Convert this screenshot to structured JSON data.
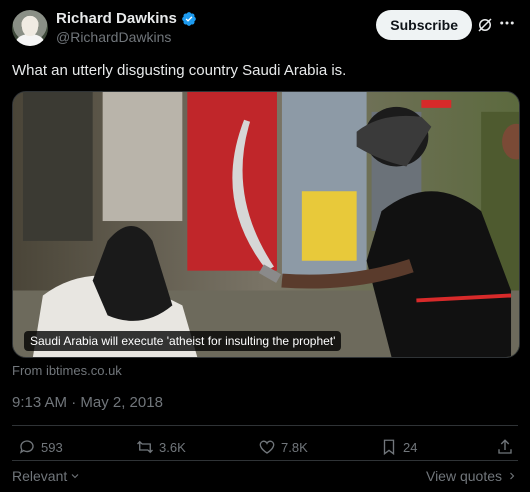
{
  "author": {
    "name": "Richard Dawkins",
    "handle": "@RichardDawkins",
    "verified": true
  },
  "header": {
    "subscribe_label": "Subscribe"
  },
  "tweet": {
    "text": "What an utterly disgusting country Saudi Arabia is.",
    "media_caption": "Saudi Arabia will execute 'atheist for insulting the prophet'",
    "source": "From ibtimes.co.uk",
    "timestamp": "9:13 AM · May 2, 2018"
  },
  "actions": {
    "replies": "593",
    "retweets": "3.6K",
    "likes": "7.8K",
    "bookmarks": "24"
  },
  "footer": {
    "sort_label": "Relevant",
    "view_quotes_label": "View quotes"
  },
  "icons": {
    "verified": "verified-badge-icon",
    "grok": "grok-icon",
    "more": "more-icon",
    "reply": "reply-icon",
    "retweet": "retweet-icon",
    "like": "heart-icon",
    "bookmark": "bookmark-icon",
    "share": "share-icon"
  },
  "colors": {
    "background": "#000000",
    "text": "#e7e9ea",
    "muted": "#71767b",
    "verified": "#1d9bf0",
    "subscribe_bg": "#eff3f4"
  }
}
